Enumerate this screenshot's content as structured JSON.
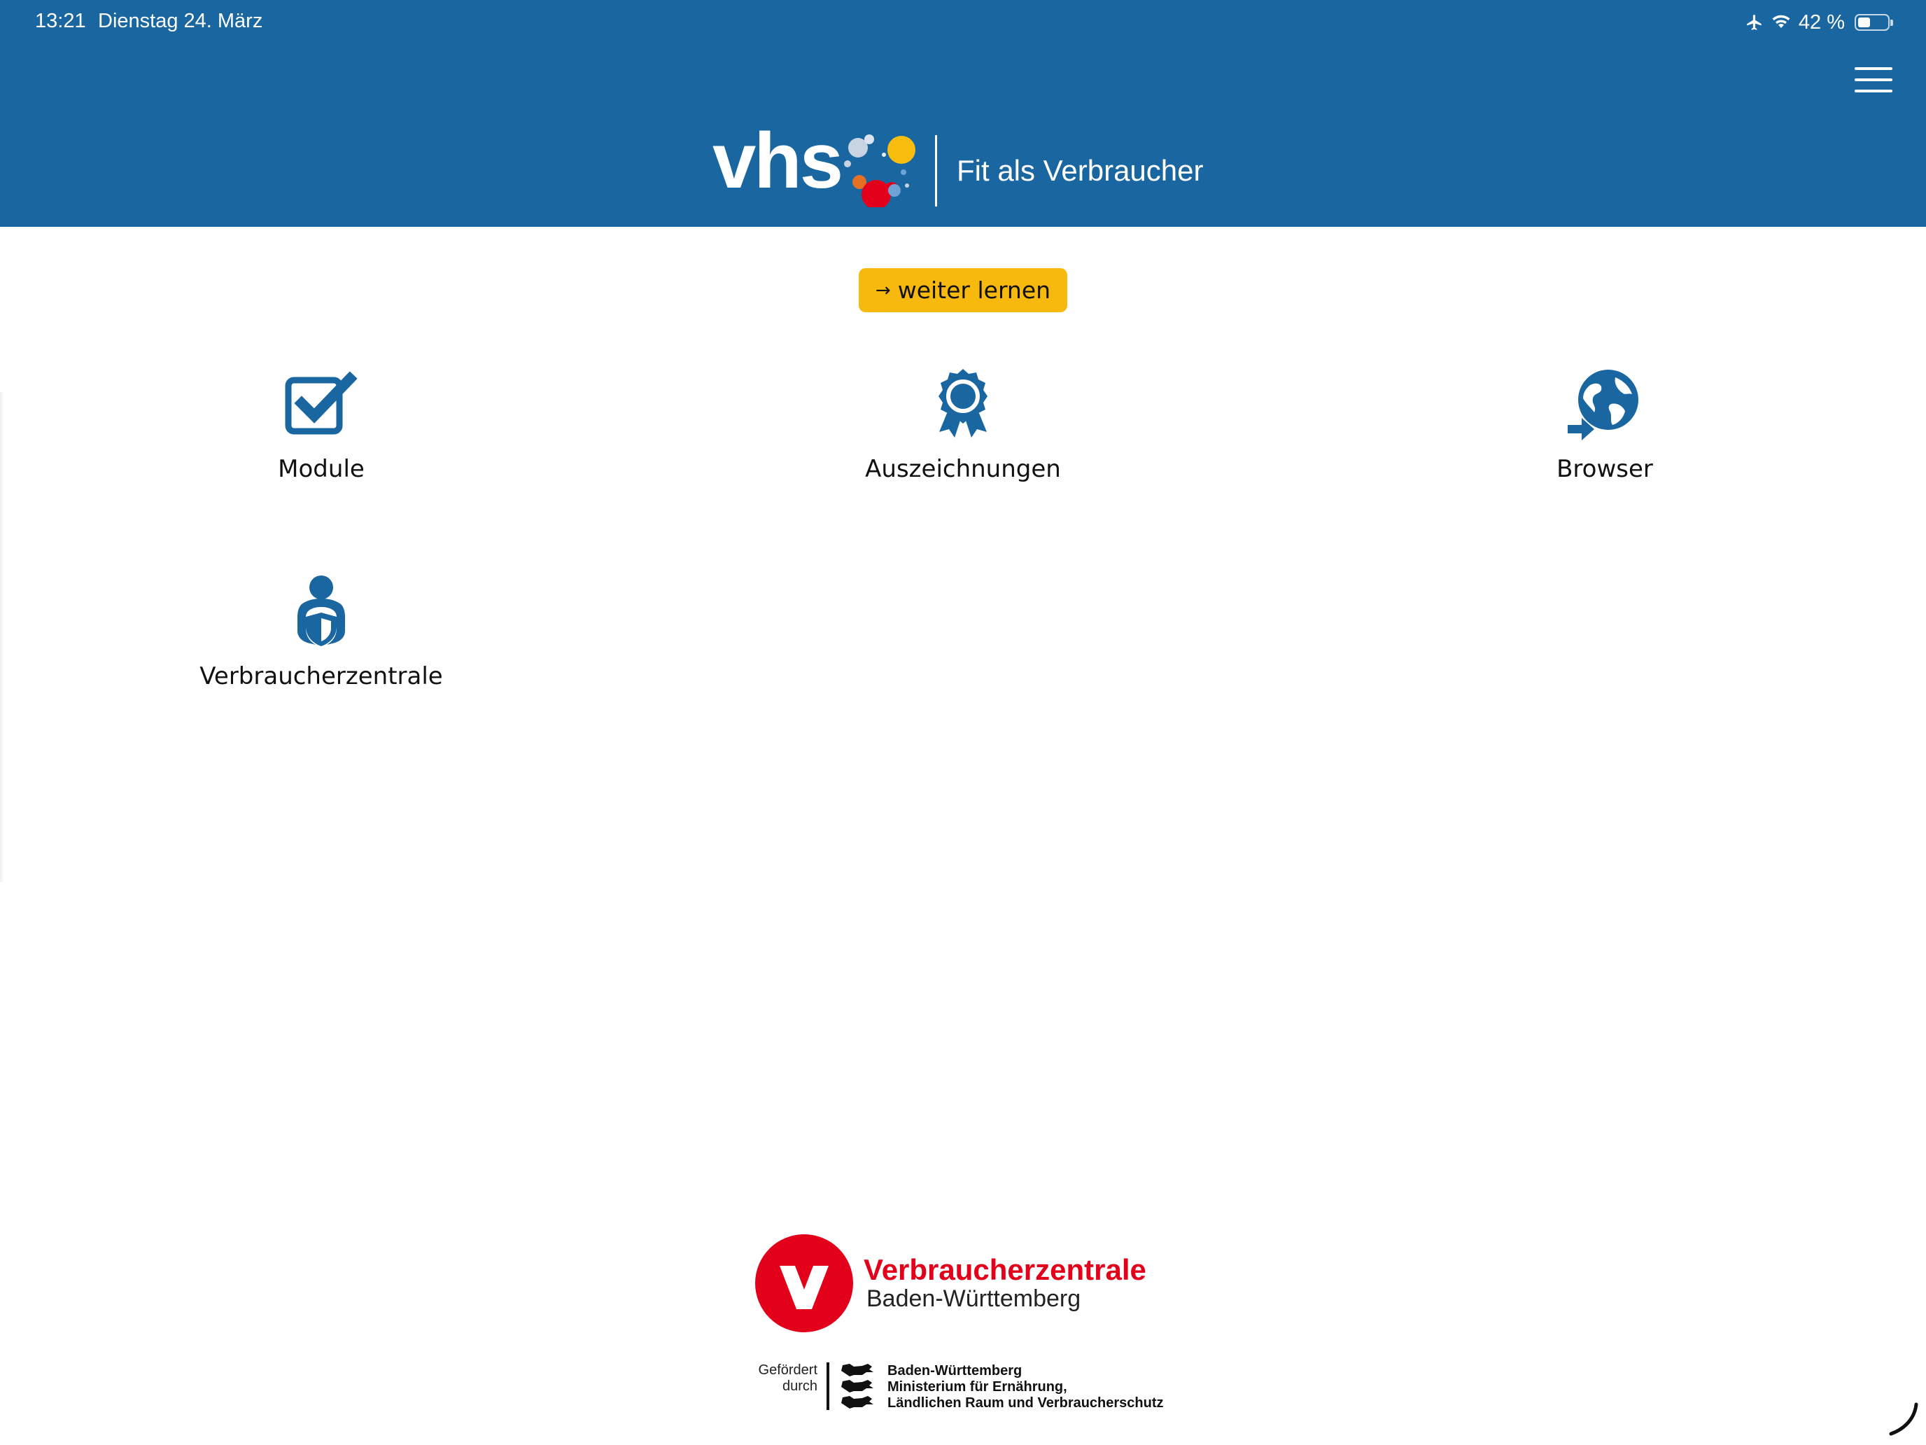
{
  "status_bar": {
    "time": "13:21",
    "date": "Dienstag 24. März",
    "battery_text": "42 %",
    "battery_level": 0.42
  },
  "header": {
    "logo_text": "vhs",
    "title": "Fit als Verbraucher",
    "background_color": "#1a66a0"
  },
  "cta": {
    "arrow": "→",
    "label": "weiter lernen",
    "color": "#f7b90d"
  },
  "tiles": [
    {
      "label": "Module",
      "icon": "checkbox-icon"
    },
    {
      "label": "Auszeichnungen",
      "icon": "award-icon"
    },
    {
      "label": "Browser",
      "icon": "globe-icon"
    },
    {
      "label": "Verbraucherzentrale",
      "icon": "person-shield-icon"
    }
  ],
  "footer": {
    "vz_name": "Verbraucherzentrale",
    "vz_region": "Baden-Württemberg",
    "funded_line1": "Gefördert",
    "funded_line2": "durch",
    "ministry_line1": "Baden-Württemberg",
    "ministry_line2": "Ministerium für Ernährung,",
    "ministry_line3": "Ländlichen Raum und Verbraucherschutz",
    "vz_color": "#e2001a"
  }
}
